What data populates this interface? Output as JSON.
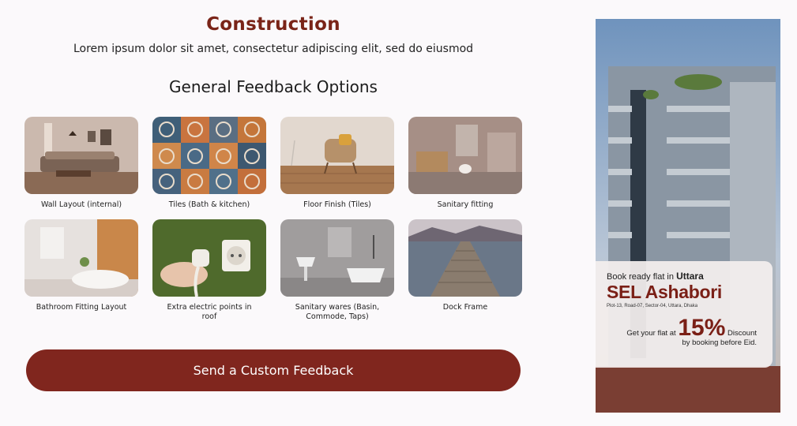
{
  "page": {
    "title": "Construction",
    "subtitle": "Lorem ipsum dolor sit amet, consectetur adipiscing elit, sed do eiusmod",
    "section_title": "General Feedback Options"
  },
  "options": [
    {
      "label": "Wall Layout (internal)",
      "image": "living-room-image"
    },
    {
      "label": "Tiles (Bath & kitchen)",
      "image": "patterned-tiles-image"
    },
    {
      "label": "Floor Finish (Tiles)",
      "image": "armchair-floor-image"
    },
    {
      "label": "Sanitary fitting",
      "image": "bathroom-vanity-image"
    },
    {
      "label": "Bathroom Fitting Layout",
      "image": "bathroom-bathtub-image"
    },
    {
      "label": "Extra electric points in roof",
      "image": "electric-socket-image"
    },
    {
      "label": "Sanitary wares (Basin, Commode, Taps)",
      "image": "bathroom-basin-image"
    },
    {
      "label": "Dock Frame",
      "image": "wooden-dock-image"
    }
  ],
  "cta": {
    "label": "Send a Custom Feedback"
  },
  "ad": {
    "lead": "Book ready flat in ",
    "lead_bold": "Uttara",
    "project_name": "SEL Ashabori",
    "address": "Plot-13, Road-07, Sector-04, Uttara, Dhaka",
    "offer_pre": "Get your flat at ",
    "offer_percent": "15%",
    "offer_post": " Discount",
    "offer_line2": "by booking before Eid."
  },
  "colors": {
    "brand": "#80261e",
    "title": "#7a2418",
    "background": "#fbf9fb"
  }
}
